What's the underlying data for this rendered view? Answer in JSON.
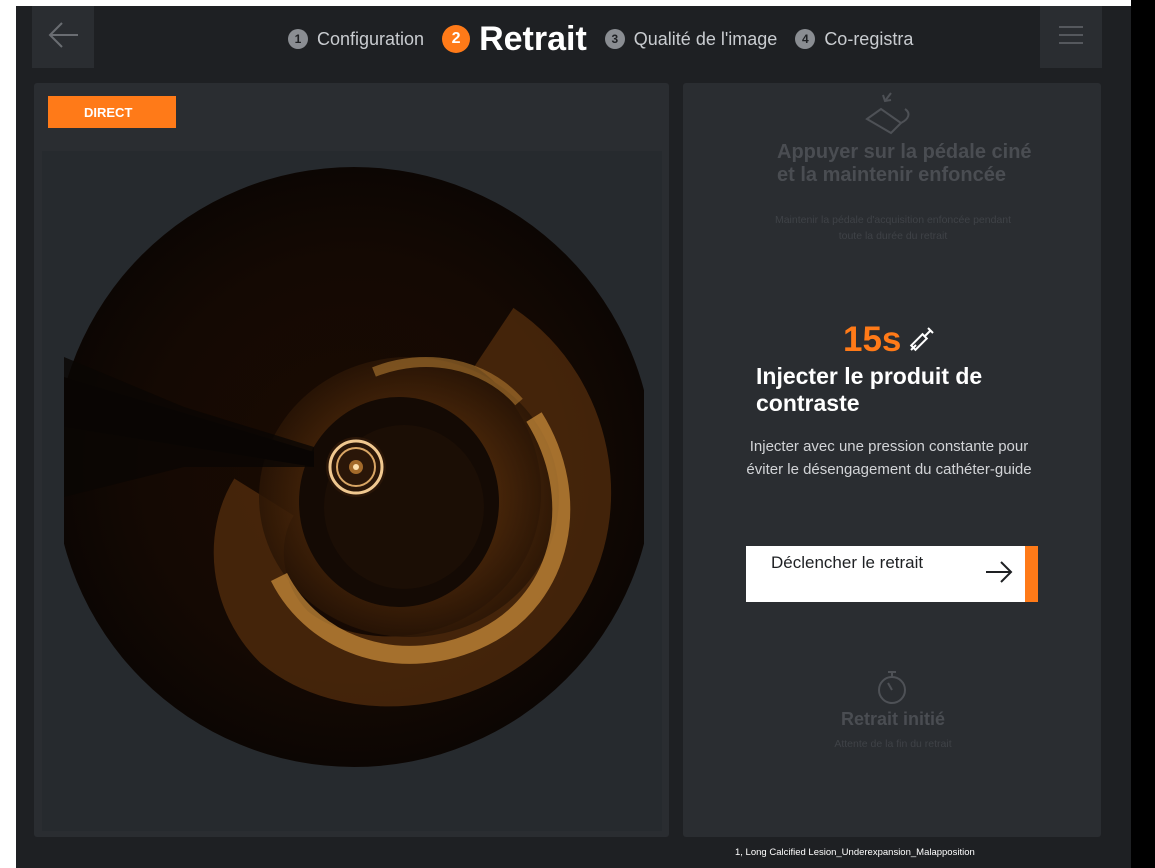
{
  "topbar": {
    "back_icon": "arrow-left-icon",
    "menu_icon": "hamburger-menu-icon",
    "steps": [
      {
        "number": "1",
        "label": "Configuration",
        "active": false
      },
      {
        "number": "2",
        "label": "Retrait",
        "active": true
      },
      {
        "number": "3",
        "label": "Qualité de l'image",
        "active": false
      },
      {
        "number": "4",
        "label": "Co-registra",
        "active": false
      }
    ]
  },
  "live_view": {
    "badge": "DIRECT"
  },
  "instructions": {
    "step_pedal": {
      "icon": "foot-pedal-icon",
      "title": "Appuyer sur la pédale ciné et la maintenir enfoncée",
      "description": "Maintenir la pédale d'acquisition enfoncée pendant toute la durée du retrait"
    },
    "step_inject": {
      "timer": "15s",
      "icon": "syringe-icon",
      "title": "Injecter le produit de contraste",
      "description": "Injecter avec une pression constante pour éviter le désengagement du cathéter-guide",
      "button_label": "Déclencher le retrait",
      "button_icon": "arrow-right-icon"
    },
    "step_pullback": {
      "icon": "stopwatch-icon",
      "title": "Retrait initié",
      "description": "Attente de la fin du retrait"
    }
  },
  "caption": "1, Long Calcified Lesion_Underexpansion_Malapposition",
  "colors": {
    "accent": "#ff7a18",
    "background": "#1e2023",
    "panel": "#2a2d31"
  }
}
